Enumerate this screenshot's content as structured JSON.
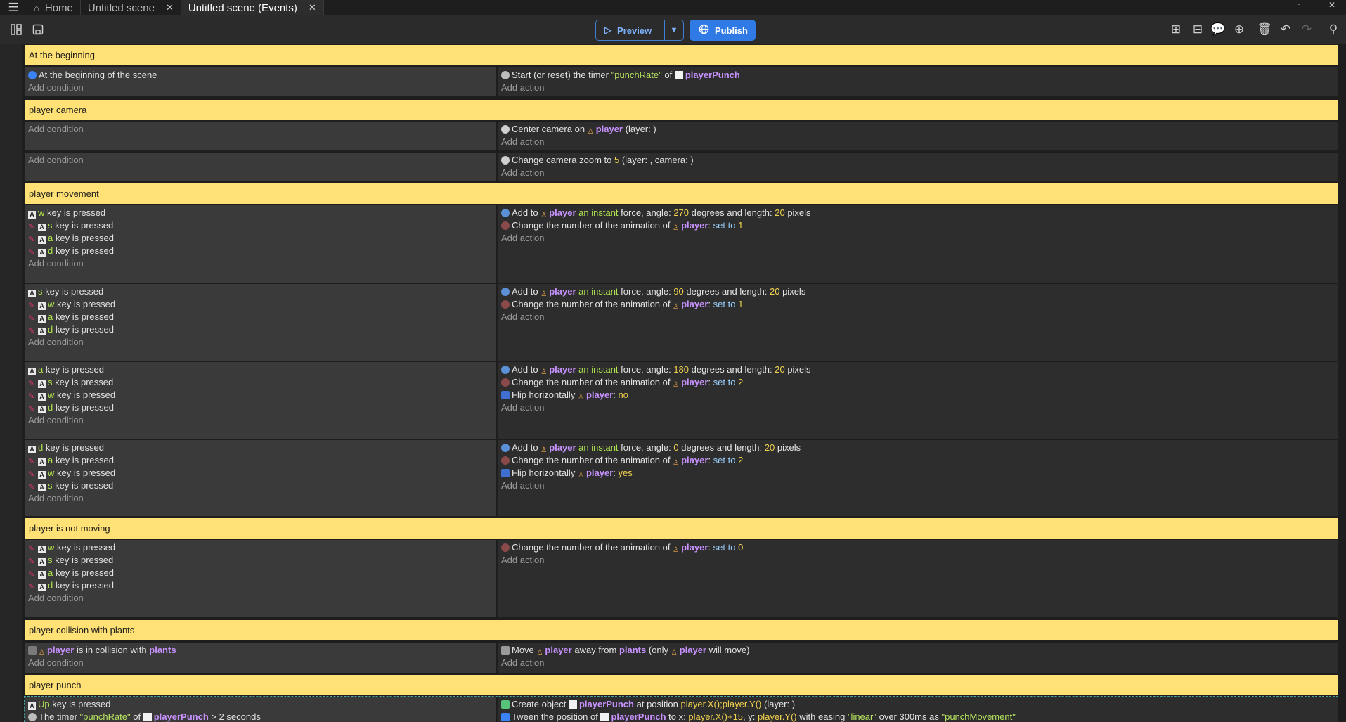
{
  "tabs": [
    {
      "label": "Home"
    },
    {
      "label": "Untitled scene"
    },
    {
      "label": "Untitled scene (Events)"
    }
  ],
  "toolbar": {
    "preview_label": "Preview",
    "publish_label": "Publish"
  },
  "common": {
    "add_condition": "Add condition",
    "add_action": "Add action",
    "key_pressed": "key is pressed",
    "player": "player",
    "anim_text": "Change the number of the animation of",
    "set_to": "set to",
    "flip_text": "Flip horizontally"
  },
  "comments": [
    "At the beginning",
    "player camera",
    "player movement",
    "player is not moving",
    "player collision with plants",
    "player punch"
  ],
  "ev0": {
    "cond": "At the beginning of the scene",
    "act_pre": "Start (or reset) the timer",
    "timer": "\"punchRate\"",
    "of": "of",
    "obj": "playerPunch"
  },
  "ev1": {
    "act_pre": "Center camera on",
    "act_post": "(layer: )"
  },
  "ev2": {
    "act_pre": "Change camera zoom to",
    "zoom": "5",
    "act_post": "(layer: , camera: )"
  },
  "force": {
    "add_to": "Add to",
    "instant": "an instant",
    "force_angle": "force, angle:",
    "deg_len": "degrees and length:",
    "pixels": "pixels"
  },
  "movement": [
    {
      "keys": [
        "w",
        "s",
        "a",
        "d"
      ],
      "angle": "270",
      "length": "20",
      "anim": "1",
      "flip": null
    },
    {
      "keys": [
        "s",
        "w",
        "a",
        "d"
      ],
      "angle": "90",
      "length": "20",
      "anim": "1",
      "flip": null
    },
    {
      "keys": [
        "a",
        "s",
        "w",
        "d"
      ],
      "angle": "180",
      "length": "20",
      "anim": "2",
      "flip": "no"
    },
    {
      "keys": [
        "d",
        "a",
        "w",
        "s"
      ],
      "angle": "0",
      "length": "20",
      "anim": "2",
      "flip": "yes"
    }
  ],
  "notmoving": {
    "keys": [
      "w",
      "s",
      "a",
      "d"
    ],
    "anim": "0"
  },
  "collision": {
    "cond_mid": "is in collision with",
    "plants": "plants",
    "act_pre": "Move",
    "act_mid": "away from",
    "act_mid2": "(only",
    "act_post": "will move)"
  },
  "punch": {
    "key": "Up",
    "act1_pre": "Create object",
    "obj": "playerPunch",
    "act1_mid": "at position",
    "act1_pos": "player.X();player.Y()",
    "act1_post": "(layer: )",
    "cond2_pre": "The timer",
    "cond2_timer": "\"punchRate\"",
    "cond2_of": "of",
    "cond2_cmp": "> 2 seconds",
    "act2_pre": "Tween the position of",
    "act2_to": "to x:",
    "act2_x": "player.X()+15",
    "act2_y_l": ", y:",
    "act2_y": "player.Y()",
    "act2_ease": "with easing",
    "act2_ease_v": "\"linear\"",
    "act2_over": "over 300ms as",
    "act2_name": "\"punchMovement\""
  }
}
